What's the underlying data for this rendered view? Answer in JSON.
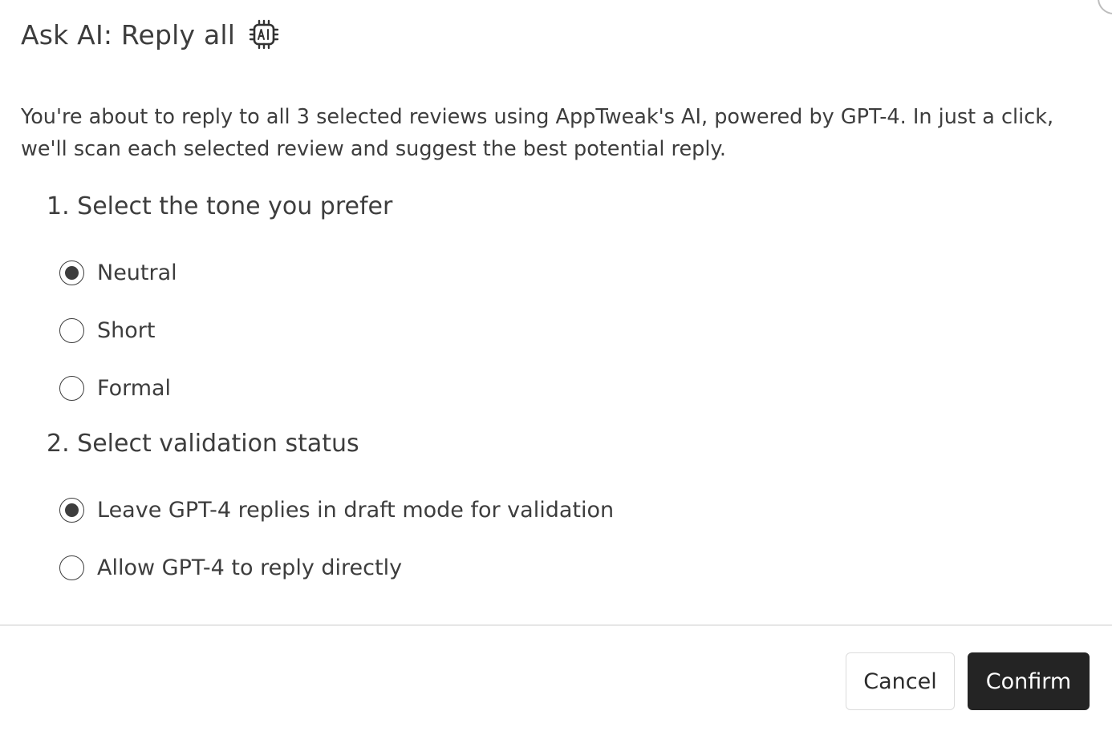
{
  "dialog": {
    "title": "Ask AI: Reply all",
    "title_icon": "ai-chip-icon",
    "description": "You're about to reply to all 3 selected reviews using AppTweak's AI, powered by GPT-4. In just a click, we'll scan each selected review and suggest the best potential reply."
  },
  "tone": {
    "heading": "1. Select the tone you prefer",
    "selected": "Neutral",
    "options": [
      {
        "label": "Neutral",
        "checked": true
      },
      {
        "label": "Short",
        "checked": false
      },
      {
        "label": "Formal",
        "checked": false
      }
    ]
  },
  "validation": {
    "heading": "2. Select validation status",
    "selected": "Leave GPT-4 replies in draft mode for validation",
    "options": [
      {
        "label": "Leave GPT-4 replies in draft mode for validation",
        "checked": true
      },
      {
        "label": "Allow GPT-4 to reply directly",
        "checked": false
      }
    ]
  },
  "footer": {
    "cancel_label": "Cancel",
    "confirm_label": "Confirm"
  },
  "colors": {
    "text": "#3d3d3d",
    "confirm_bg": "#242424",
    "divider": "#e6e6e6"
  }
}
